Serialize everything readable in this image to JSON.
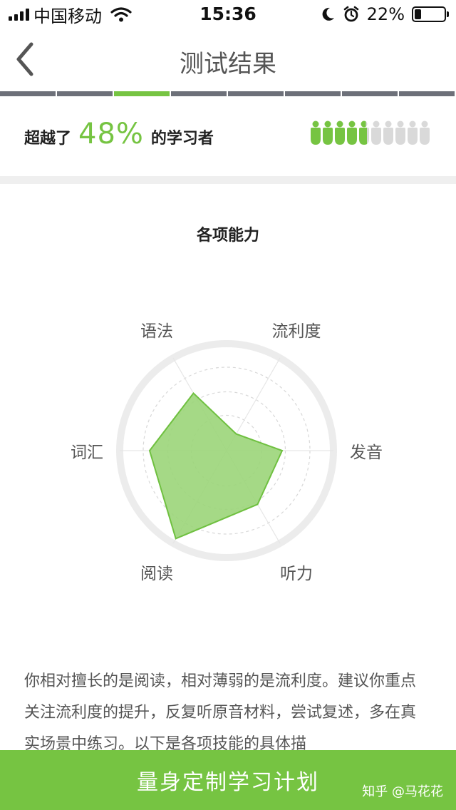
{
  "status_bar": {
    "carrier": "中国移动",
    "time": "15:36",
    "battery_percent_text": "22%",
    "battery_level": 0.22
  },
  "nav": {
    "title": "测试结果"
  },
  "progress": {
    "segment_count": 8,
    "active_index": 2
  },
  "summary": {
    "prefix": "超越了",
    "percent": "48%",
    "suffix": "的学习者",
    "people_total": 10,
    "people_filled": 4.8
  },
  "abilities": {
    "title": "各项能力",
    "axes": [
      {
        "label": "语法",
        "value": 0.62
      },
      {
        "label": "流利度",
        "value": 0.18
      },
      {
        "label": "发音",
        "value": 0.52
      },
      {
        "label": "听力",
        "value": 0.58
      },
      {
        "label": "阅读",
        "value": 0.95
      },
      {
        "label": "词汇",
        "value": 0.72
      }
    ]
  },
  "description": {
    "text": "你相对擅长的是阅读，相对薄弱的是流利度。建议你重点关注流利度的提升，反复听原音材料，尝试复述，多在真实场景中练习。以下是各项技能的具体描"
  },
  "cta": {
    "label": "量身定制学习计划",
    "watermark": "知乎 @马花花"
  },
  "colors": {
    "accent": "#76c442",
    "radar_fill": "#9bd579",
    "radar_stroke": "#6fc040",
    "segment_inactive": "#6d7079",
    "people_empty": "#d9d9d9"
  },
  "icons": {
    "back": "chevron-left-icon",
    "wifi": "wifi-icon",
    "moon": "moon-icon",
    "alarm": "alarm-clock-icon",
    "battery": "battery-icon",
    "person": "person-icon"
  }
}
